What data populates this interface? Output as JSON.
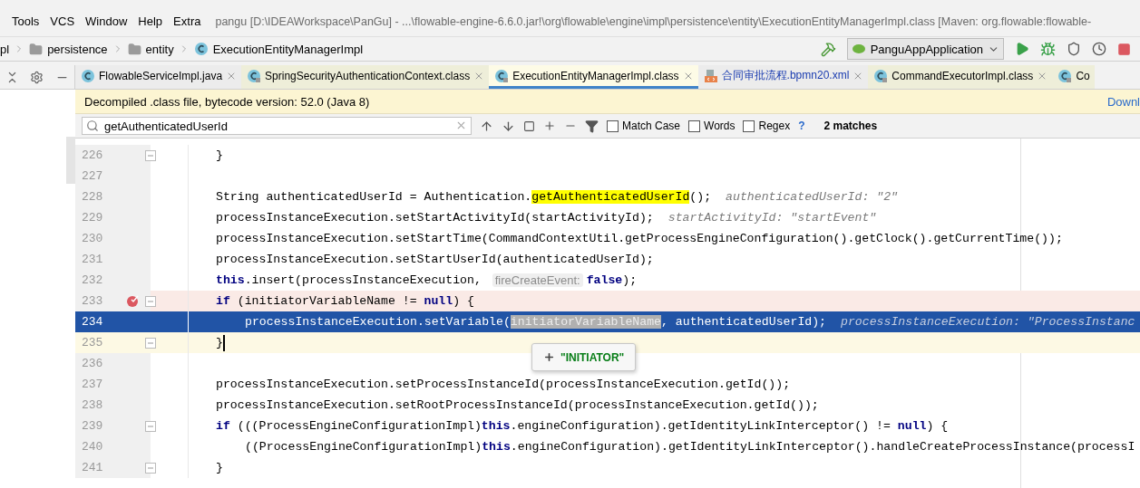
{
  "menu": [
    {
      "label": "Tools"
    },
    {
      "label": "VCS"
    },
    {
      "label": "Window"
    },
    {
      "label": "Help"
    },
    {
      "label": "Extra"
    }
  ],
  "window_title": "pangu [D:\\IDEAWorkspace\\PanGu] - ...\\flowable-engine-6.6.0.jar!\\org\\flowable\\engine\\impl\\persistence\\entity\\ExecutionEntityManagerImpl.class [Maven: org.flowable:flowable-",
  "breadcrumbs": [
    {
      "label": "pl",
      "kind": "text"
    },
    {
      "label": "persistence",
      "kind": "folder"
    },
    {
      "label": "entity",
      "kind": "folder"
    },
    {
      "label": "ExecutionEntityManagerImpl",
      "kind": "class"
    }
  ],
  "run_config": "PanguAppApplication",
  "tabs": [
    {
      "label": "FlowableServiceImpl.java",
      "kind": "java",
      "selected": false
    },
    {
      "label": "SpringSecurityAuthenticationContext.class",
      "kind": "class",
      "selected": false
    },
    {
      "label": "ExecutionEntityManagerImpl.class",
      "kind": "class",
      "selected": true
    },
    {
      "label": "合同审批流程.bpmn20.xml",
      "kind": "xml",
      "selected": false
    },
    {
      "label": "CommandExecutorImpl.class",
      "kind": "class",
      "selected": false
    },
    {
      "label": "Co",
      "kind": "class",
      "selected": false
    }
  ],
  "banner": {
    "text": "Decompiled .class file, bytecode version: 52.0 (Java 8)",
    "link": "Downl"
  },
  "search": {
    "value": "getAuthenticatedUserId",
    "options": [
      {
        "label": "Match Case",
        "checked": false
      },
      {
        "label": "Words",
        "checked": false
      },
      {
        "label": "Regex",
        "checked": false
      }
    ],
    "help": "?",
    "result": "2 matches"
  },
  "code": [
    {
      "number": "226",
      "fold": true,
      "nested": false,
      "breakpoint": false,
      "execution": false,
      "caret": false,
      "tokens": [
        {
          "kind": "code",
          "text": "}"
        }
      ]
    },
    {
      "number": "227"
    },
    {
      "number": "228",
      "fold": false,
      "nested": false,
      "breakpoint": false,
      "execution": false,
      "caret": false,
      "tokens": [
        {
          "kind": "code",
          "text": "String authenticatedUserId = Authentication."
        },
        {
          "kind": "match",
          "text": "getAuthenticatedUserId"
        },
        {
          "kind": "code",
          "text": "();"
        },
        {
          "kind": "hint",
          "text": "authenticatedUserId: \"2\""
        }
      ]
    },
    {
      "number": "229",
      "fold": false,
      "nested": false,
      "breakpoint": false,
      "execution": false,
      "caret": false,
      "tokens": [
        {
          "kind": "code",
          "text": "processInstanceExecution.setStartActivityId(startActivityId);"
        },
        {
          "kind": "hint",
          "text": "startActivityId: \"startEvent\""
        }
      ]
    },
    {
      "number": "230",
      "fold": false,
      "nested": false,
      "breakpoint": false,
      "execution": false,
      "caret": false,
      "tokens": [
        {
          "kind": "code",
          "text": "processInstanceExecution.setStartTime(CommandContextUtil.getProcessEngineConfiguration().getClock().getCurrentTime());"
        }
      ]
    },
    {
      "number": "231",
      "fold": false,
      "nested": false,
      "breakpoint": false,
      "execution": false,
      "caret": false,
      "tokens": [
        {
          "kind": "code",
          "text": "processInstanceExecution.setStartUserId(authenticatedUserId);"
        }
      ]
    },
    {
      "number": "232",
      "fold": false,
      "nested": false,
      "breakpoint": false,
      "execution": false,
      "caret": false,
      "tokens": [
        {
          "kind": "keyword",
          "text": "this"
        },
        {
          "kind": "code",
          "text": ".insert(processInstanceExecution, "
        },
        {
          "kind": "param",
          "text": "fireCreateEvent:"
        },
        {
          "kind": "keyword",
          "text": "false"
        },
        {
          "kind": "code",
          "text": ");"
        }
      ]
    },
    {
      "number": "233",
      "fold": true,
      "nested": false,
      "breakpoint": true,
      "execution": false,
      "caret": false,
      "tokens": [
        {
          "kind": "keyword",
          "text": "if"
        },
        {
          "kind": "code",
          "text": " (initiatorVariableName != "
        },
        {
          "kind": "keyword",
          "text": "null"
        },
        {
          "kind": "code",
          "text": ") {"
        }
      ]
    },
    {
      "number": "234",
      "fold": false,
      "nested": true,
      "breakpoint": false,
      "execution": true,
      "caret": false,
      "tokens": [
        {
          "kind": "code",
          "text": "processInstanceExecution.setVariable("
        },
        {
          "kind": "selection",
          "text": "initiatorVariableName"
        },
        {
          "kind": "code",
          "text": ", authenticatedUserId);"
        },
        {
          "kind": "hint",
          "text": "processInstanceExecution: \"ProcessInstanc"
        }
      ]
    },
    {
      "number": "235",
      "fold": true,
      "nested": false,
      "breakpoint": false,
      "execution": false,
      "caret": true,
      "tokens": [
        {
          "kind": "code",
          "text": "}"
        }
      ]
    },
    {
      "number": "236"
    },
    {
      "number": "237",
      "fold": false,
      "nested": false,
      "breakpoint": false,
      "execution": false,
      "caret": false,
      "tokens": [
        {
          "kind": "code",
          "text": "processInstanceExecution.setProcessInstanceId(processInstanceExecution.getId());"
        }
      ]
    },
    {
      "number": "238",
      "fold": false,
      "nested": false,
      "breakpoint": false,
      "execution": false,
      "caret": false,
      "tokens": [
        {
          "kind": "code",
          "text": "processInstanceExecution.setRootProcessInstanceId(processInstanceExecution.getId());"
        }
      ]
    },
    {
      "number": "239",
      "fold": true,
      "nested": false,
      "breakpoint": false,
      "execution": false,
      "caret": false,
      "tokens": [
        {
          "kind": "keyword",
          "text": "if"
        },
        {
          "kind": "code",
          "text": " (((ProcessEngineConfigurationImpl)"
        },
        {
          "kind": "keyword",
          "text": "this"
        },
        {
          "kind": "code",
          "text": ".engineConfiguration).getIdentityLinkInterceptor() != "
        },
        {
          "kind": "keyword",
          "text": "null"
        },
        {
          "kind": "code",
          "text": ") {"
        }
      ]
    },
    {
      "number": "240",
      "fold": false,
      "nested": true,
      "breakpoint": false,
      "execution": false,
      "caret": false,
      "tokens": [
        {
          "kind": "code",
          "text": "((ProcessEngineConfigurationImpl)"
        },
        {
          "kind": "keyword",
          "text": "this"
        },
        {
          "kind": "code",
          "text": ".engineConfiguration).getIdentityLinkInterceptor().handleCreateProcessInstance(processI"
        }
      ]
    },
    {
      "number": "241",
      "fold": true,
      "nested": false,
      "breakpoint": false,
      "execution": false,
      "caret": false,
      "tokens": [
        {
          "kind": "code",
          "text": "}"
        }
      ]
    }
  ],
  "tooltip": {
    "text": "\"INITIATOR\""
  }
}
